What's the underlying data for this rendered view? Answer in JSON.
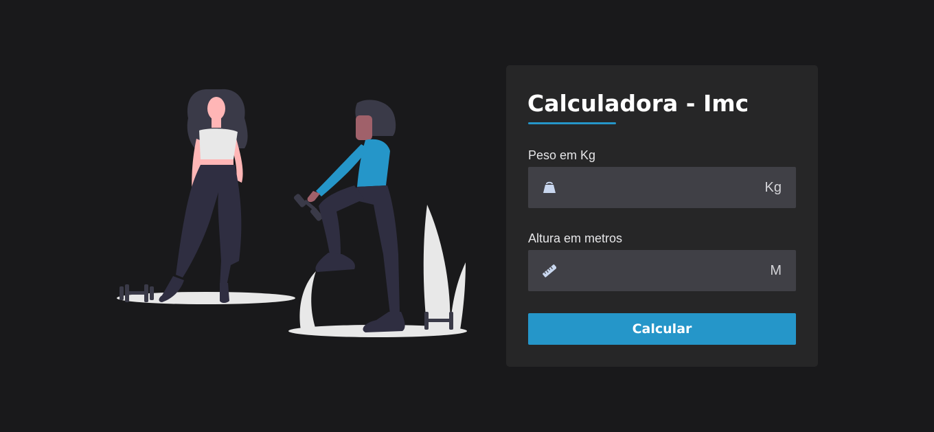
{
  "form": {
    "title": "Calculadora - Imc",
    "weight": {
      "label": "Peso em Kg",
      "value": "",
      "placeholder": "",
      "unit": "Kg",
      "icon": "weight-icon"
    },
    "height": {
      "label": "Altura em metros",
      "value": "",
      "placeholder": "",
      "unit": "M",
      "icon": "ruler-icon"
    },
    "submit_label": "Calcular"
  },
  "theme": {
    "background": "#19191b",
    "card": "#262627",
    "field": "#404046",
    "accent": "#2596c9",
    "text": "#ffffff"
  },
  "illustration": {
    "icon": "fitness-illustration"
  }
}
